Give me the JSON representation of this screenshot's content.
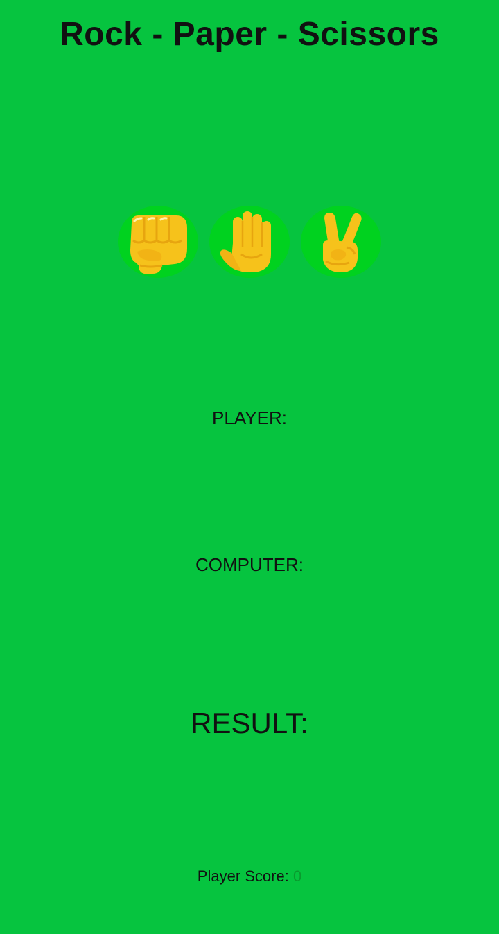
{
  "title": "Rock - Paper - Scissors",
  "choices": [
    {
      "name": "rock",
      "icon": "fist-icon"
    },
    {
      "name": "paper",
      "icon": "raised-hand-icon"
    },
    {
      "name": "scissors",
      "icon": "victory-hand-icon"
    }
  ],
  "labels": {
    "player": "PLAYER:",
    "computer": "COMPUTER:",
    "result": "RESULT:"
  },
  "score": {
    "label": "Player Score: ",
    "value": "0"
  },
  "colors": {
    "background": "#06c43f",
    "button": "#00d21f",
    "emoji": "#f6c21b",
    "score_value": "#0a9a2e"
  }
}
